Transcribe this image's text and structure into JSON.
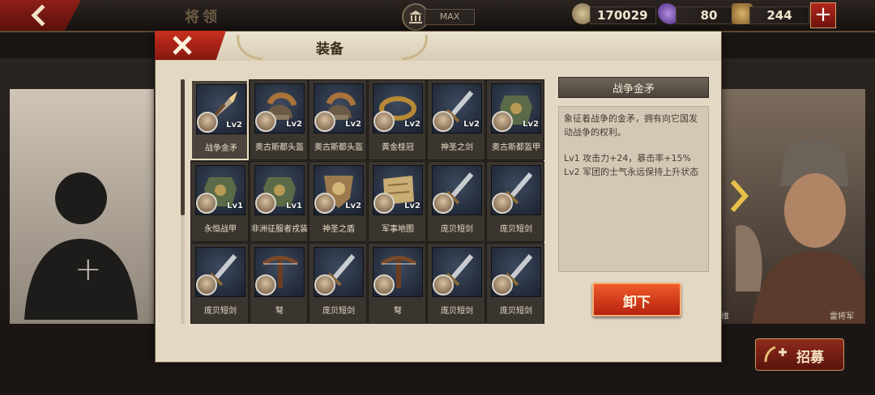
{
  "topbar": {
    "title": "将领",
    "max_label": "MAX",
    "coins": "170029",
    "gems": "80",
    "troops": "244",
    "plus_label": "+"
  },
  "background": {
    "add_slot_label": "+",
    "right_names": [
      "维",
      "雷将军"
    ]
  },
  "recruit": {
    "label": "招募"
  },
  "modal": {
    "title": "装备",
    "items": [
      {
        "name": "战争金矛",
        "lv": "Lv2",
        "icon": "spear-icon",
        "selected": true
      },
      {
        "name": "奥古斯都头盔",
        "lv": "Lv2",
        "icon": "helmet-icon"
      },
      {
        "name": "奥古斯都头盔",
        "lv": "Lv2",
        "icon": "helmet-icon"
      },
      {
        "name": "黄金桂冠",
        "lv": "Lv2",
        "icon": "wreath-icon"
      },
      {
        "name": "神圣之剑",
        "lv": "Lv2",
        "icon": "sword-icon"
      },
      {
        "name": "奥古斯都盔甲",
        "lv": "Lv2",
        "icon": "armor-icon"
      },
      {
        "name": "永恒战甲",
        "lv": "Lv1",
        "icon": "armor-icon"
      },
      {
        "name": "非洲征服者戎装",
        "lv": "Lv1",
        "icon": "armor-icon"
      },
      {
        "name": "神圣之盾",
        "lv": "Lv2",
        "icon": "shield-icon"
      },
      {
        "name": "军事地图",
        "lv": "Lv2",
        "icon": "map-icon"
      },
      {
        "name": "庞贝短剑",
        "lv": "",
        "icon": "sword-icon"
      },
      {
        "name": "庞贝短剑",
        "lv": "",
        "icon": "sword-icon"
      },
      {
        "name": "庞贝短剑",
        "lv": "",
        "icon": "sword-icon"
      },
      {
        "name": "弩",
        "lv": "",
        "icon": "crossbow-icon"
      },
      {
        "name": "庞贝短剑",
        "lv": "",
        "icon": "sword-icon"
      },
      {
        "name": "弩",
        "lv": "",
        "icon": "crossbow-icon"
      },
      {
        "name": "庞贝短剑",
        "lv": "",
        "icon": "sword-icon"
      },
      {
        "name": "庞贝短剑",
        "lv": "",
        "icon": "sword-icon"
      }
    ],
    "detail": {
      "title": "战争金矛",
      "desc_line1": "象征着战争的金矛，拥有向它国发",
      "desc_line2": "动战争的权利。",
      "lv1": "Lv1  攻击力+24，暴击率+15%",
      "lv2": "Lv2  军团的士气永远保持上升状态"
    },
    "unequip_label": "卸下"
  },
  "colors": {
    "accent_red": "#c9301f",
    "button_orange": "#ef5b2a",
    "panel_bg": "#e3d8c4",
    "grid_bg": "#2d2823"
  }
}
